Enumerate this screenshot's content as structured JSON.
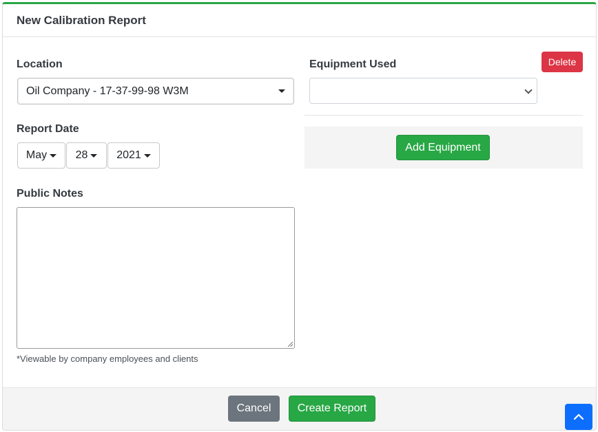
{
  "header": {
    "title": "New Calibration Report"
  },
  "location": {
    "label": "Location",
    "value": "Oil Company - 17-37-99-98 W3M"
  },
  "report_date": {
    "label": "Report Date",
    "month": "May",
    "day": "28",
    "year": "2021"
  },
  "public_notes": {
    "label": "Public Notes",
    "value": "",
    "hint": "*Viewable by company employees and clients"
  },
  "equipment": {
    "label": "Equipment Used",
    "selected": "",
    "delete_label": "Delete",
    "add_label": "Add Equipment"
  },
  "footer": {
    "cancel_label": "Cancel",
    "create_label": "Create Report"
  },
  "icons": {
    "dropdown": "caret-down-icon",
    "scroll_top": "chevron-up-icon",
    "resize": "resize-grip-icon"
  },
  "colors": {
    "accent_green": "#28a745",
    "danger": "#dc3545",
    "secondary": "#6c757d",
    "primary": "#0d6efd"
  }
}
